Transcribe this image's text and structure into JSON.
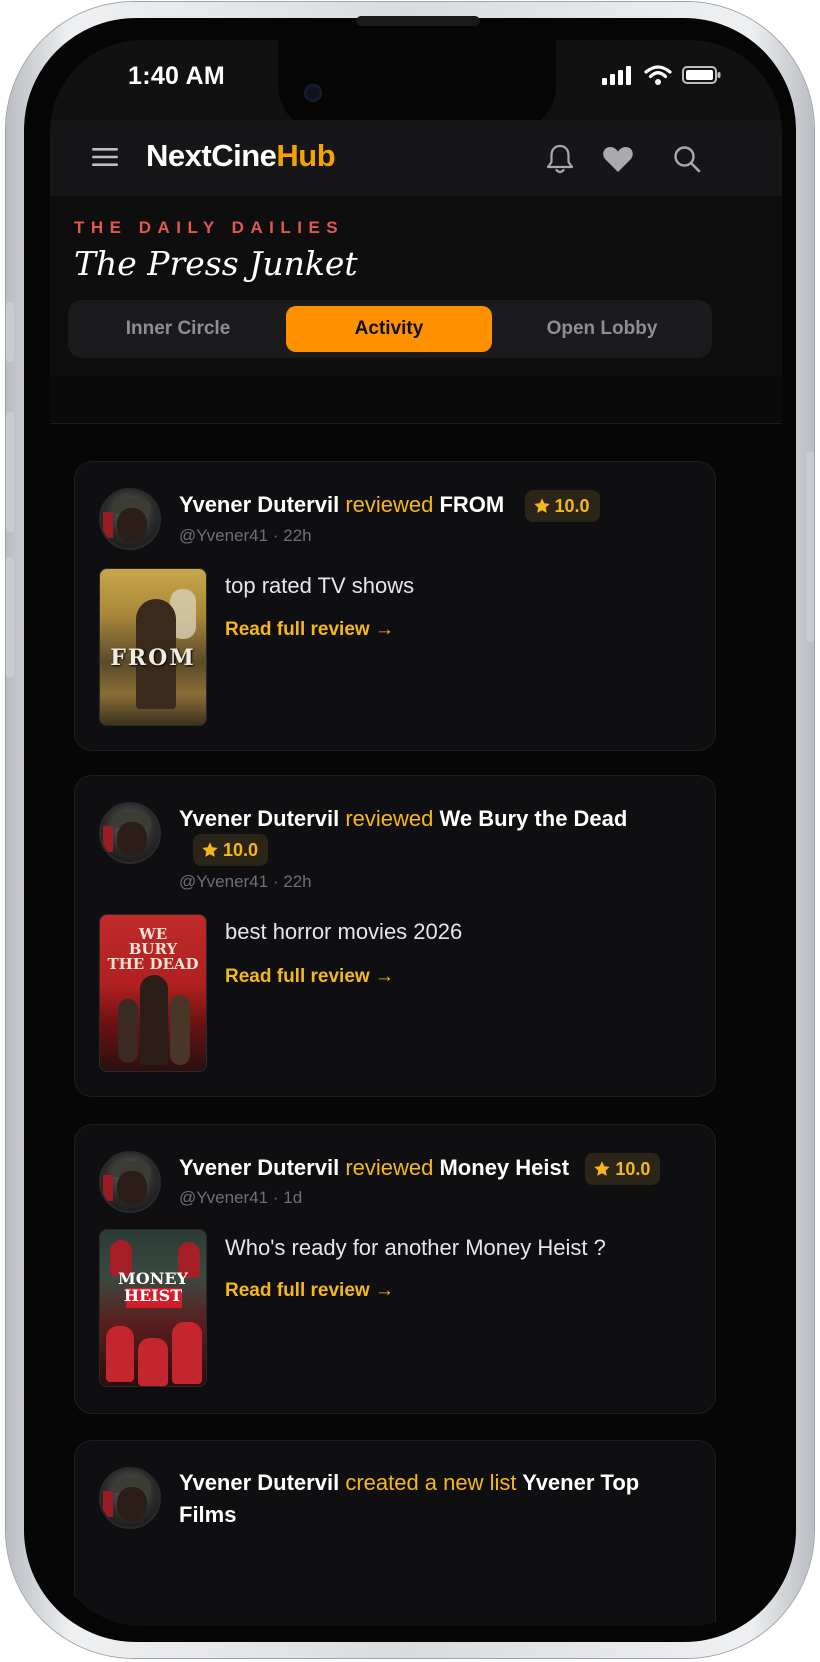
{
  "status_bar": {
    "time": "1:40 AM"
  },
  "app": {
    "brand_part1": "NextCine",
    "brand_part2": "Hub"
  },
  "section": {
    "kicker": "THE DAILY DAILIES",
    "title": "The Press Junket",
    "tabs": [
      {
        "label": "Inner Circle",
        "active": false
      },
      {
        "label": "Activity",
        "active": true
      },
      {
        "label": "Open Lobby",
        "active": false
      }
    ]
  },
  "feed": [
    {
      "user": "Yvener Dutervil",
      "verb": "reviewed",
      "title": "FROM",
      "rating": "10.0",
      "handle": "@Yvener41",
      "age": "22h",
      "text": "top rated TV shows",
      "link": "Read full review →",
      "poster_text": "FROM"
    },
    {
      "user": "Yvener Dutervil",
      "verb": "reviewed",
      "title": "We Bury the Dead",
      "rating": "10.0",
      "handle": "@Yvener41",
      "age": "22h",
      "text": "best horror movies 2026",
      "link": "Read full review →",
      "poster_text_1": "WE",
      "poster_text_2": "BURY",
      "poster_text_3": "THE DEAD"
    },
    {
      "user": "Yvener Dutervil",
      "verb": "reviewed",
      "title": "Money Heist",
      "rating": "10.0",
      "handle": "@Yvener41",
      "age": "1d",
      "text": "Who's ready for another Money Heist ?",
      "link": "Read full review →",
      "poster_text_1": "MONEY",
      "poster_text_2": "HEIST"
    },
    {
      "user": "Yvener Dutervil",
      "verb": "created a new list",
      "title": "Yvener Top Films"
    }
  ],
  "meta_separator": "·",
  "colors": {
    "accent": "#ff9100",
    "link": "#f5b81b",
    "kicker": "#e25850",
    "background": "#060606"
  },
  "icons": [
    "menu-icon",
    "bell-icon",
    "heart-icon",
    "search-icon",
    "star-icon",
    "signal-icon",
    "wifi-icon",
    "battery-icon"
  ]
}
